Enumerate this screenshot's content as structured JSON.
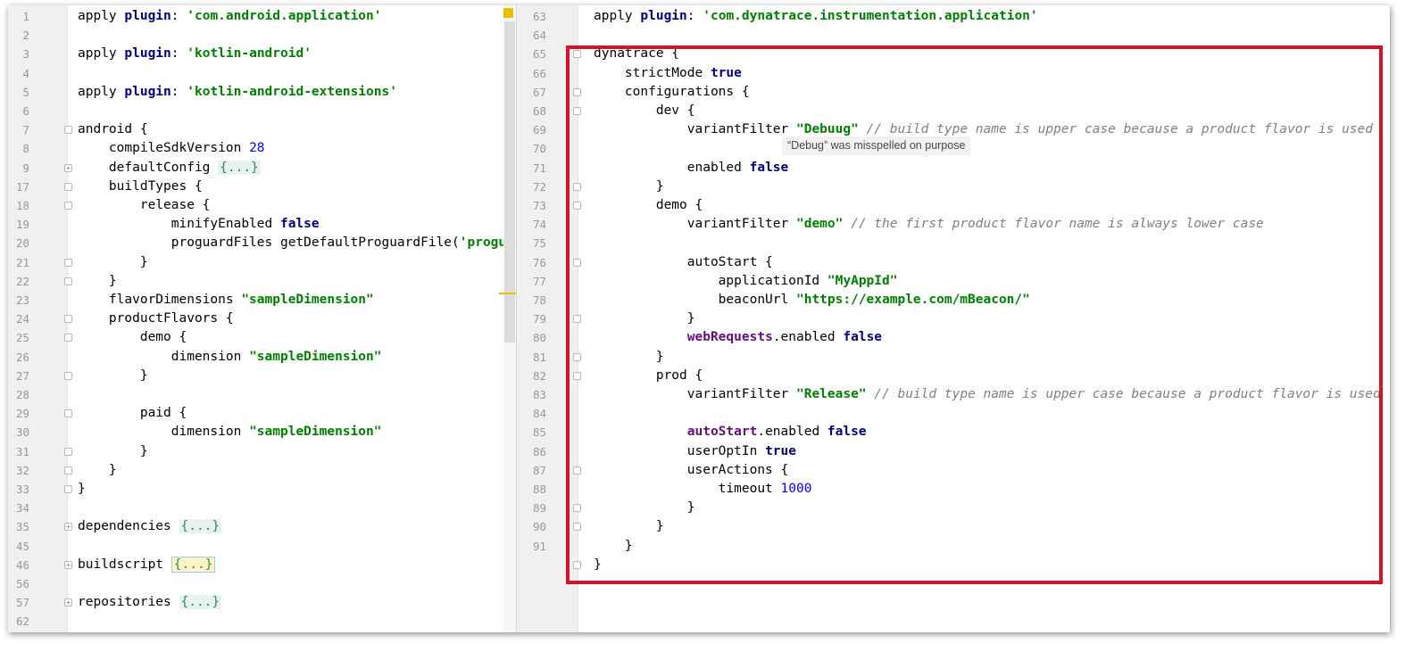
{
  "left_editor": {
    "lines": [
      {
        "n": "1",
        "parts": [
          [
            "apply ",
            "plain"
          ],
          [
            "plugin",
            "kw"
          ],
          [
            ": ",
            "plain"
          ],
          [
            "'com.android.application'",
            "str"
          ]
        ]
      },
      {
        "n": "2",
        "parts": []
      },
      {
        "n": "3",
        "parts": [
          [
            "apply ",
            "plain"
          ],
          [
            "plugin",
            "kw"
          ],
          [
            ": ",
            "plain"
          ],
          [
            "'kotlin-android'",
            "str"
          ]
        ]
      },
      {
        "n": "4",
        "parts": []
      },
      {
        "n": "5",
        "parts": [
          [
            "apply ",
            "plain"
          ],
          [
            "plugin",
            "kw"
          ],
          [
            ": ",
            "plain"
          ],
          [
            "'kotlin-android-extensions'",
            "str"
          ]
        ]
      },
      {
        "n": "6",
        "parts": []
      },
      {
        "n": "7",
        "fold": "-",
        "parts": [
          [
            "android {",
            "plain"
          ]
        ]
      },
      {
        "n": "8",
        "parts": [
          [
            "    compileSdkVersion ",
            "plain"
          ],
          [
            "28",
            "num"
          ]
        ]
      },
      {
        "n": "9",
        "fold": "+",
        "parts": [
          [
            "    defaultConfig ",
            "plain"
          ],
          [
            "{...}",
            "folded"
          ]
        ]
      },
      {
        "n": "17",
        "fold": "-",
        "parts": [
          [
            "    buildTypes {",
            "plain"
          ]
        ]
      },
      {
        "n": "18",
        "fold": "-",
        "parts": [
          [
            "        release {",
            "plain"
          ]
        ]
      },
      {
        "n": "19",
        "parts": [
          [
            "            minifyEnabled ",
            "plain"
          ],
          [
            "false",
            "kw"
          ]
        ]
      },
      {
        "n": "20",
        "parts": [
          [
            "            proguardFiles getDefaultProguardFile(",
            "plain"
          ],
          [
            "'proguard-android.txt'",
            "str"
          ]
        ]
      },
      {
        "n": "21",
        "fold": "-",
        "parts": [
          [
            "        }",
            "plain"
          ]
        ]
      },
      {
        "n": "22",
        "fold": "-",
        "parts": [
          [
            "    }",
            "plain"
          ]
        ]
      },
      {
        "n": "23",
        "parts": [
          [
            "    flavorDimensions ",
            "plain"
          ],
          [
            "\"sampleDimension\"",
            "str"
          ]
        ]
      },
      {
        "n": "24",
        "fold": "-",
        "parts": [
          [
            "    productFlavors {",
            "plain"
          ]
        ]
      },
      {
        "n": "25",
        "fold": "-",
        "parts": [
          [
            "        demo {",
            "plain"
          ]
        ]
      },
      {
        "n": "26",
        "parts": [
          [
            "            dimension ",
            "plain"
          ],
          [
            "\"sampleDimension\"",
            "str"
          ]
        ]
      },
      {
        "n": "27",
        "fold": "-",
        "parts": [
          [
            "        }",
            "plain"
          ]
        ]
      },
      {
        "n": "28",
        "parts": []
      },
      {
        "n": "29",
        "fold": "-",
        "parts": [
          [
            "        paid {",
            "plain"
          ]
        ]
      },
      {
        "n": "30",
        "parts": [
          [
            "            dimension ",
            "plain"
          ],
          [
            "\"sampleDimension\"",
            "str"
          ]
        ]
      },
      {
        "n": "31",
        "fold": "-",
        "parts": [
          [
            "        }",
            "plain"
          ]
        ]
      },
      {
        "n": "32",
        "fold": "-",
        "parts": [
          [
            "    }",
            "plain"
          ]
        ]
      },
      {
        "n": "33",
        "fold": "-",
        "parts": [
          [
            "}",
            "plain"
          ]
        ]
      },
      {
        "n": "34",
        "parts": []
      },
      {
        "n": "35",
        "fold": "+",
        "parts": [
          [
            "dependencies ",
            "plain"
          ],
          [
            "{...}",
            "folded"
          ]
        ]
      },
      {
        "n": "45",
        "parts": []
      },
      {
        "n": "46",
        "fold": "+",
        "parts": [
          [
            "buildscript ",
            "plain"
          ],
          [
            "{...}",
            "folded-hl"
          ]
        ]
      },
      {
        "n": "56",
        "parts": []
      },
      {
        "n": "57",
        "fold": "+",
        "parts": [
          [
            "repositories ",
            "plain"
          ],
          [
            "{...}",
            "folded"
          ]
        ]
      },
      {
        "n": "62",
        "parts": []
      }
    ]
  },
  "right_editor": {
    "lines": [
      {
        "n": "63",
        "parts": [
          [
            "apply ",
            "plain"
          ],
          [
            "plugin",
            "kw"
          ],
          [
            ": ",
            "plain"
          ],
          [
            "'com.dynatrace.instrumentation.application'",
            "str"
          ]
        ]
      },
      {
        "n": "64",
        "parts": []
      },
      {
        "n": "65",
        "fold": "-",
        "parts": [
          [
            "dynatrace {",
            "plain"
          ]
        ]
      },
      {
        "n": "66",
        "parts": [
          [
            "    strictMode ",
            "plain"
          ],
          [
            "true",
            "kw"
          ]
        ]
      },
      {
        "n": "67",
        "fold": "-",
        "parts": [
          [
            "    configurations {",
            "plain"
          ]
        ]
      },
      {
        "n": "68",
        "fold": "-",
        "parts": [
          [
            "        dev {",
            "plain"
          ]
        ]
      },
      {
        "n": "69",
        "parts": [
          [
            "            variantFilter ",
            "plain"
          ],
          [
            "\"Debuug\"",
            "str"
          ],
          [
            " // build type name is upper case because a product flavor is used",
            "cmt"
          ]
        ]
      },
      {
        "n": "70",
        "parts": []
      },
      {
        "n": "71",
        "parts": [
          [
            "            enabled ",
            "plain"
          ],
          [
            "false",
            "kw"
          ]
        ]
      },
      {
        "n": "72",
        "fold": "-",
        "parts": [
          [
            "        }",
            "plain"
          ]
        ]
      },
      {
        "n": "73",
        "fold": "-",
        "parts": [
          [
            "        demo {",
            "plain"
          ]
        ]
      },
      {
        "n": "74",
        "parts": [
          [
            "            variantFilter ",
            "plain"
          ],
          [
            "\"demo\"",
            "str"
          ],
          [
            " // the first product flavor name is always lower case",
            "cmt"
          ]
        ]
      },
      {
        "n": "75",
        "parts": []
      },
      {
        "n": "76",
        "fold": "-",
        "parts": [
          [
            "            autoStart {",
            "plain"
          ]
        ]
      },
      {
        "n": "77",
        "parts": [
          [
            "                applicationId ",
            "plain"
          ],
          [
            "\"MyAppId\"",
            "str"
          ]
        ]
      },
      {
        "n": "78",
        "parts": [
          [
            "                beaconUrl ",
            "plain"
          ],
          [
            "\"https://example.com/mBeacon/\"",
            "str"
          ]
        ]
      },
      {
        "n": "79",
        "fold": "-",
        "parts": [
          [
            "            }",
            "plain"
          ]
        ]
      },
      {
        "n": "80",
        "parts": [
          [
            "            ",
            "plain"
          ],
          [
            "webRequests",
            "prop"
          ],
          [
            ".enabled ",
            "plain"
          ],
          [
            "false",
            "kw"
          ]
        ]
      },
      {
        "n": "81",
        "fold": "-",
        "parts": [
          [
            "        }",
            "plain"
          ]
        ]
      },
      {
        "n": "82",
        "fold": "-",
        "parts": [
          [
            "        prod {",
            "plain"
          ]
        ]
      },
      {
        "n": "83",
        "parts": [
          [
            "            variantFilter ",
            "plain"
          ],
          [
            "\"Release\"",
            "str"
          ],
          [
            " // build type name is upper case because a product flavor is used",
            "cmt"
          ]
        ]
      },
      {
        "n": "84",
        "parts": []
      },
      {
        "n": "85",
        "parts": [
          [
            "            ",
            "plain"
          ],
          [
            "autoStart",
            "prop"
          ],
          [
            ".enabled ",
            "plain"
          ],
          [
            "false",
            "kw"
          ]
        ]
      },
      {
        "n": "86",
        "parts": [
          [
            "            userOptIn ",
            "plain"
          ],
          [
            "true",
            "kw"
          ]
        ]
      },
      {
        "n": "87",
        "fold": "-",
        "parts": [
          [
            "            userActions {",
            "plain"
          ]
        ]
      },
      {
        "n": "88",
        "parts": [
          [
            "                timeout ",
            "plain"
          ],
          [
            "1000",
            "num"
          ]
        ]
      },
      {
        "n": "89",
        "fold": "-",
        "parts": [
          [
            "            }",
            "plain"
          ]
        ]
      },
      {
        "n": "90",
        "fold": "-",
        "parts": [
          [
            "        }",
            "plain"
          ]
        ]
      },
      {
        "n": "91",
        "parts": [
          [
            "    }",
            "plain"
          ]
        ]
      },
      {
        "n": "",
        "fold": "-",
        "parts": [
          [
            "}",
            "plain"
          ]
        ]
      }
    ]
  },
  "tooltip": {
    "text": "“Debug” was misspelled on purpose"
  },
  "colors": {
    "highlight_border": "#d4122b",
    "marker": "#e8c000"
  }
}
